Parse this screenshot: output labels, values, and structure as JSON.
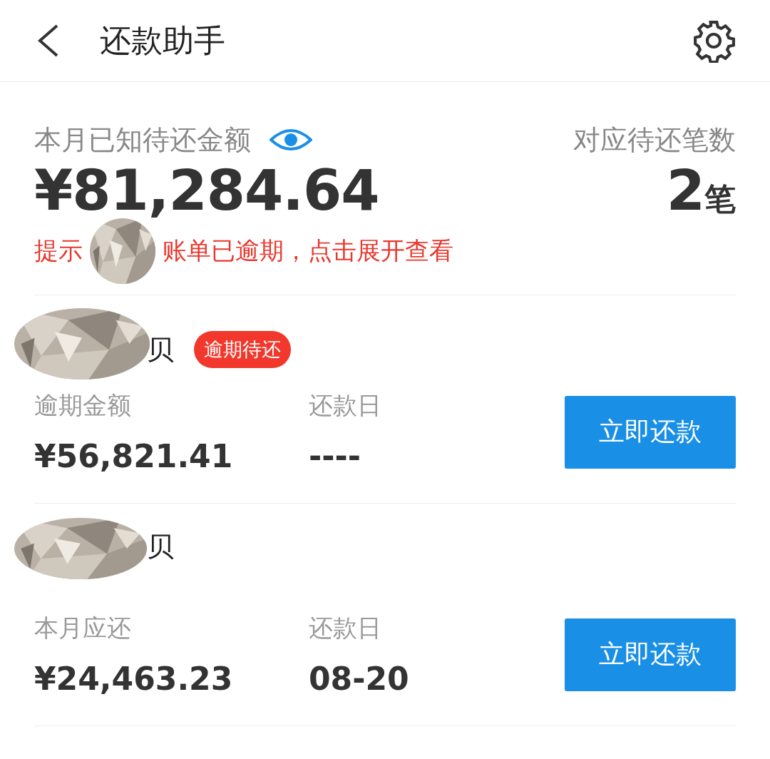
{
  "header": {
    "title": "还款助手"
  },
  "summary": {
    "label": "本月已知待还金额",
    "amount": "¥81,284.64",
    "count_label": "对应待还笔数",
    "count": "2",
    "count_unit": "笔",
    "hint_prefix": "提示",
    "hint_rest": "账单已逾期，点击展开查看"
  },
  "bills": [
    {
      "name": "贝",
      "overdue": true,
      "tag": "逾期待还",
      "amount_label": "逾期金额",
      "amount": "¥56,821.41",
      "date_label": "还款日",
      "date": "----",
      "button": "立即还款"
    },
    {
      "name": "贝",
      "overdue": false,
      "amount_label": "本月应还",
      "amount": "¥24,463.23",
      "date_label": "还款日",
      "date": "08-20",
      "button": "立即还款"
    }
  ]
}
